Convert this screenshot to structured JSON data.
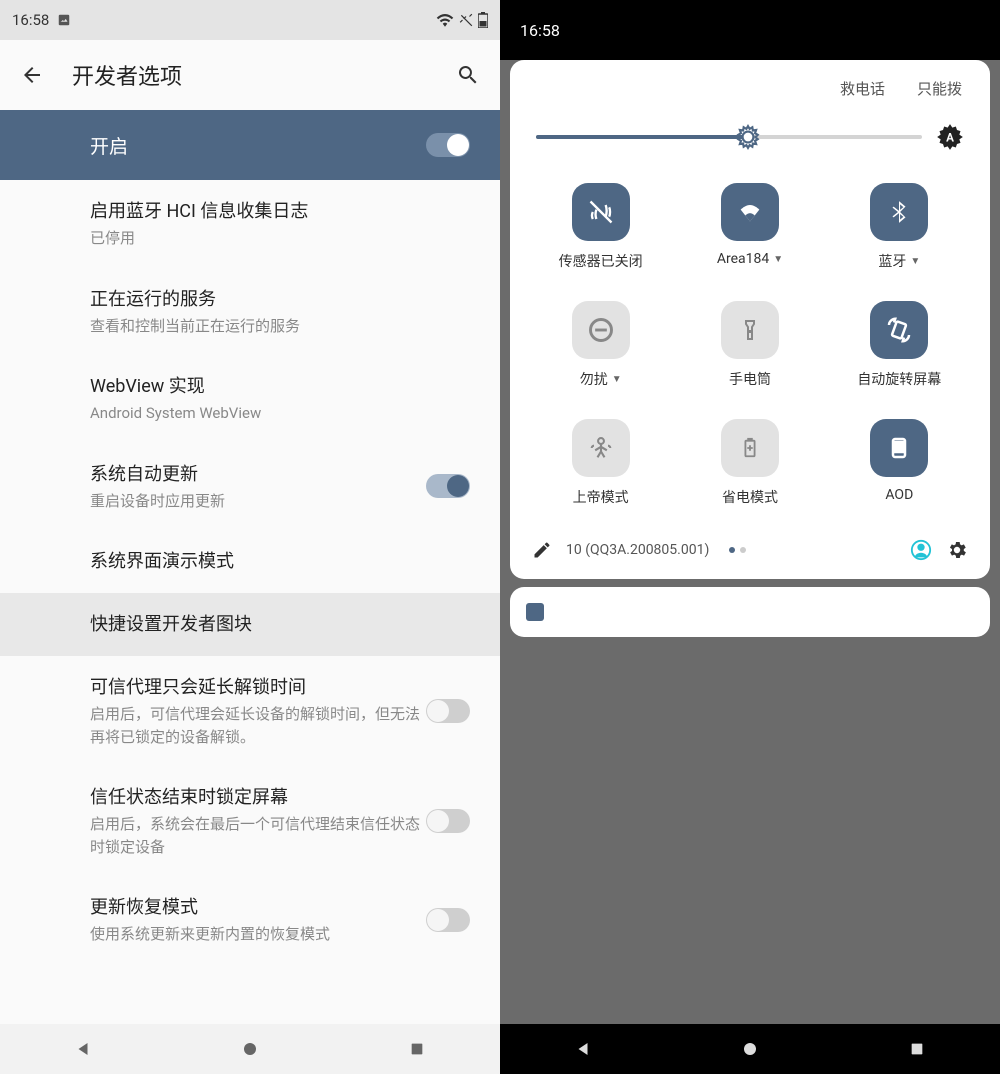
{
  "left": {
    "status_time": "16:58",
    "header_title": "开发者选项",
    "enable_bar": "开启",
    "items": [
      {
        "title": "启用蓝牙 HCI 信息收集日志",
        "sub": "已停用"
      },
      {
        "title": "正在运行的服务",
        "sub": "查看和控制当前正在运行的服务"
      },
      {
        "title": "WebView 实现",
        "sub": "Android System WebView"
      },
      {
        "title": "系统自动更新",
        "sub": "重启设备时应用更新",
        "switch": "on"
      },
      {
        "title": "系统界面演示模式"
      },
      {
        "title": "快捷设置开发者图块",
        "highlight": true
      },
      {
        "title": "可信代理只会延长解锁时间",
        "sub": "启用后，可信代理会延长设备的解锁时间，但无法再将已锁定的设备解锁。",
        "switch": "off"
      },
      {
        "title": "信任状态结束时锁定屏幕",
        "sub": "启用后，系统会在最后一个可信代理结束信任状态时锁定设备",
        "switch": "off"
      },
      {
        "title": "更新恢复模式",
        "sub": "使用系统更新来更新内置的恢复模式",
        "switch": "off"
      }
    ]
  },
  "right": {
    "status_time": "16:58",
    "top_links": [
      "救电话",
      "只能拨"
    ],
    "tiles": [
      {
        "label": "传感器已关闭",
        "icon": "sensors-off",
        "active": true
      },
      {
        "label": "Area184",
        "icon": "wifi",
        "active": true,
        "chevron": true
      },
      {
        "label": "蓝牙",
        "icon": "bluetooth",
        "active": true,
        "chevron": true
      },
      {
        "label": "勿扰",
        "icon": "dnd",
        "active": false,
        "chevron": true
      },
      {
        "label": "手电筒",
        "icon": "flashlight",
        "active": false
      },
      {
        "label": "自动旋转屏幕",
        "icon": "rotate",
        "active": true
      },
      {
        "label": "上帝模式",
        "icon": "god",
        "active": false
      },
      {
        "label": "省电模式",
        "icon": "battery",
        "active": false
      },
      {
        "label": "AOD",
        "icon": "aod",
        "active": true
      }
    ],
    "build": "10 (QQ3A.200805.001)"
  }
}
